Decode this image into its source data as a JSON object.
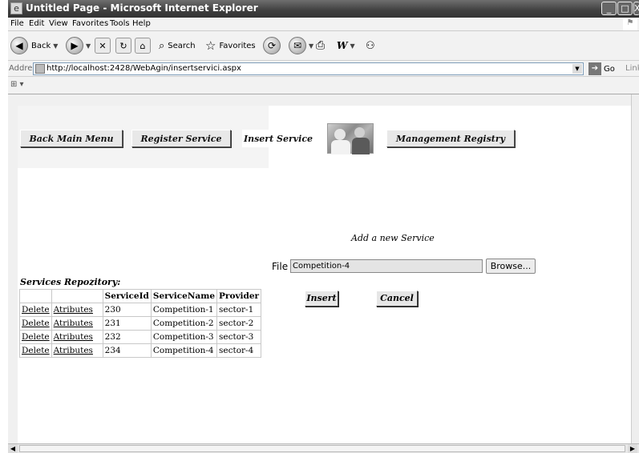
{
  "window": {
    "title": "Untitled Page - Microsoft Internet Explorer",
    "minimize": "_",
    "maximize": "□",
    "close": "X"
  },
  "menu": [
    "File",
    "Edit",
    "View",
    "Favorites",
    "Tools",
    "Help"
  ],
  "toolbar": {
    "back_label": "Back",
    "search_label": "Search",
    "favorites_label": "Favorites"
  },
  "address": {
    "label": "Address",
    "url": "http://localhost:2428/WebAgin/insertservici.aspx",
    "go_label": "Go",
    "links_label": "Links"
  },
  "nav": {
    "back_main_menu": "Back Main Menu",
    "register_service": "Register Service",
    "insert_service": "Insert Service",
    "management_registry": "Management Registry"
  },
  "form": {
    "title": "Add  a new Service",
    "file_label": "File",
    "file_value": "Competition-4",
    "browse_label": "Browse...",
    "insert_label": "Insert",
    "cancel_label": "Cancel"
  },
  "repository": {
    "title": "Services Repozitory:",
    "headers": [
      "",
      "",
      "ServiceId",
      "ServiceName",
      "Provider"
    ],
    "rows": [
      {
        "del": "Delete",
        "attr": "Atributes",
        "id": "230",
        "name": "Competition-1",
        "provider": "sector-1"
      },
      {
        "del": "Delete",
        "attr": "Atributes",
        "id": "231",
        "name": "Competition-2",
        "provider": "sector-2"
      },
      {
        "del": "Delete",
        "attr": "Atributes",
        "id": "232",
        "name": "Competition-3",
        "provider": "sector-3"
      },
      {
        "del": "Delete",
        "attr": "Atributes",
        "id": "234",
        "name": "Competition-4",
        "provider": "sector-4"
      }
    ]
  }
}
